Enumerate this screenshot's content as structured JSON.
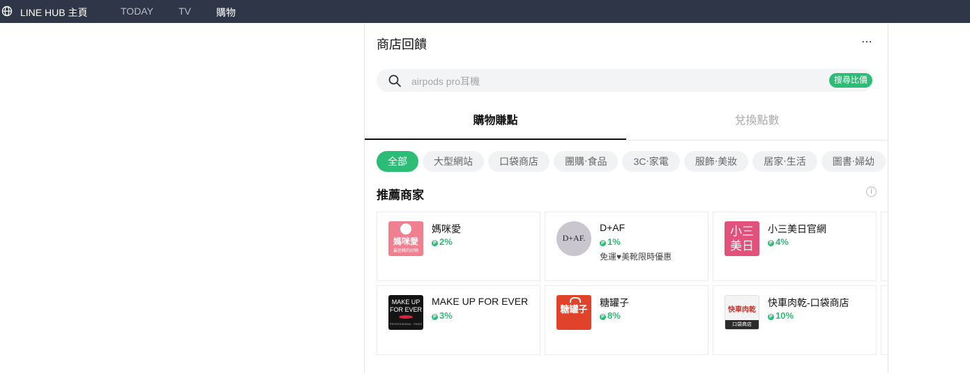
{
  "topbar": {
    "brand": "LINE HUB 主頁",
    "nav": [
      "TODAY",
      "TV",
      "購物"
    ]
  },
  "panel": {
    "title": "商店回饋",
    "more_icon": "⋯",
    "search": {
      "placeholder": "airpods pro耳機",
      "button": "搜尋比價"
    },
    "tabs": [
      "購物賺點",
      "兌換點數"
    ],
    "categories": [
      "全部",
      "大型網站",
      "口袋商店",
      "團購‧食品",
      "3C‧家電",
      "服飾‧美妝",
      "居家‧生活",
      "圖書‧婦幼"
    ],
    "section_title": "推薦商家",
    "info_icon": "i",
    "merchants": [
      {
        "name": "媽咪愛",
        "rate": "2%",
        "logo_text": "媽咪愛",
        "logo_sub": "最信賴的好物",
        "promo": ""
      },
      {
        "name": "D+AF",
        "rate": "1%",
        "logo_text": "D+AF.",
        "promo": "免運♥美靴限時優惠"
      },
      {
        "name": "小三美日官網",
        "rate": "4%",
        "logo_text": "小三美日",
        "promo": ""
      },
      {
        "name": "MAKE UP FOR EVER",
        "rate": "3%",
        "logo_text": "MAKE UP FOR EVER",
        "logo_sub": "PROFESSIONAL · PARIS",
        "promo": ""
      },
      {
        "name": "糖罐子",
        "rate": "8%",
        "logo_text": "糖罐子",
        "promo": ""
      },
      {
        "name": "快車肉乾-口袋商店",
        "rate": "10%",
        "logo_text": "快車肉乾",
        "logo_sub": "口袋商店",
        "promo": ""
      }
    ]
  },
  "colors": {
    "topbar": "#2f3647",
    "accent_green": "#2dbc75",
    "chip_bg": "#f1f2f3"
  }
}
